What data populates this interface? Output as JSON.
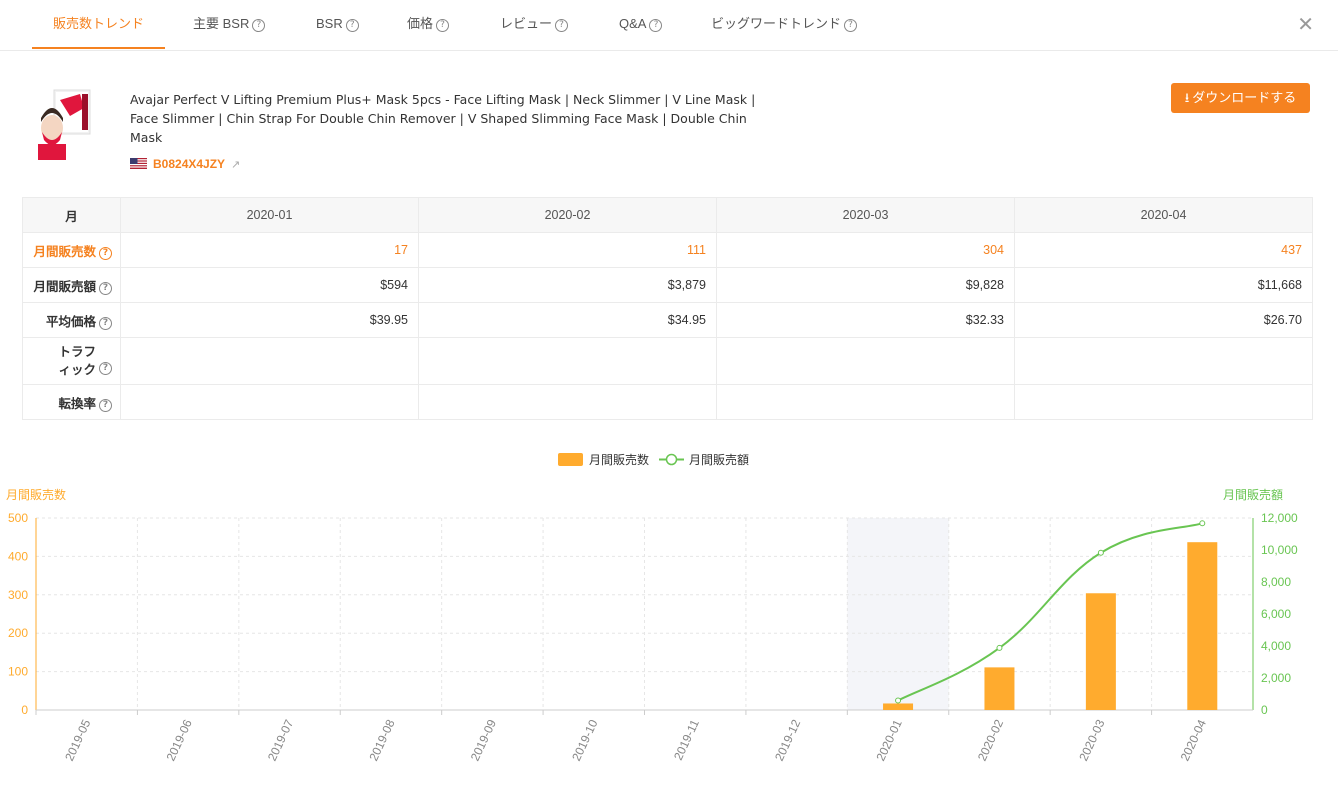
{
  "tabs": [
    {
      "label": "販売数トレンド",
      "help": false
    },
    {
      "label": "主要 BSR",
      "help": true
    },
    {
      "label": "BSR",
      "help": true
    },
    {
      "label": "価格",
      "help": true
    },
    {
      "label": "レビュー",
      "help": true
    },
    {
      "label": "Q&A",
      "help": true
    },
    {
      "label": "ビッグワードトレンド",
      "help": true
    }
  ],
  "close_symbol": "✕",
  "help_symbol": "?",
  "product": {
    "title": "Avajar Perfect V Lifting Premium Plus+ Mask 5pcs - Face Lifting Mask | Neck Slimmer | V Line Mask | Face Slimmer | Chin Strap For Double Chin Remover | V Shaped Slimming Face Mask | Double Chin Mask",
    "asin": "B0824X4JZY",
    "flag": "us-flag-icon"
  },
  "download_label": "ダウンロードする",
  "table": {
    "header_label": "月",
    "months": [
      "2020-01",
      "2020-02",
      "2020-03",
      "2020-04"
    ],
    "rows": [
      {
        "label": "月間販売数",
        "values": [
          "17",
          "111",
          "304",
          "437"
        ],
        "highlight": true
      },
      {
        "label": "月間販売額",
        "values": [
          "$594",
          "$3,879",
          "$9,828",
          "$11,668"
        ]
      },
      {
        "label": "平均価格",
        "values": [
          "$39.95",
          "$34.95",
          "$32.33",
          "$26.70"
        ]
      },
      {
        "label": "トラフィック",
        "values": [
          "",
          "",
          "",
          ""
        ]
      },
      {
        "label": "転換率",
        "values": [
          "",
          "",
          "",
          ""
        ]
      }
    ]
  },
  "colors": {
    "accent": "#f58220",
    "bar": "#ffab2e",
    "line": "#69c552",
    "grid": "#e6e6e6"
  },
  "chart_data": {
    "type": "bar",
    "categories": [
      "2019-05",
      "2019-06",
      "2019-07",
      "2019-08",
      "2019-09",
      "2019-10",
      "2019-11",
      "2019-12",
      "2020-01",
      "2020-02",
      "2020-03",
      "2020-04"
    ],
    "series": [
      {
        "name": "月間販売数",
        "type": "bar",
        "axis": "left",
        "values": [
          0,
          0,
          0,
          0,
          0,
          0,
          0,
          0,
          17,
          111,
          304,
          437
        ]
      },
      {
        "name": "月間販売額",
        "type": "line",
        "axis": "right",
        "values": [
          null,
          null,
          null,
          null,
          null,
          null,
          null,
          null,
          594,
          3879,
          9828,
          11668
        ]
      }
    ],
    "ylabel_left": "月間販売数",
    "ylabel_right": "月間販売額",
    "ylim_left": [
      0,
      500
    ],
    "yticks_left": [
      "0",
      "100",
      "200",
      "300",
      "400",
      "500"
    ],
    "ylim_right": [
      0,
      12000
    ],
    "yticks_right": [
      "0",
      "2,000",
      "4,000",
      "6,000",
      "8,000",
      "10,000",
      "12,000"
    ],
    "highlighted_category": "2020-01",
    "legend_position": "top-center",
    "grid": true
  }
}
